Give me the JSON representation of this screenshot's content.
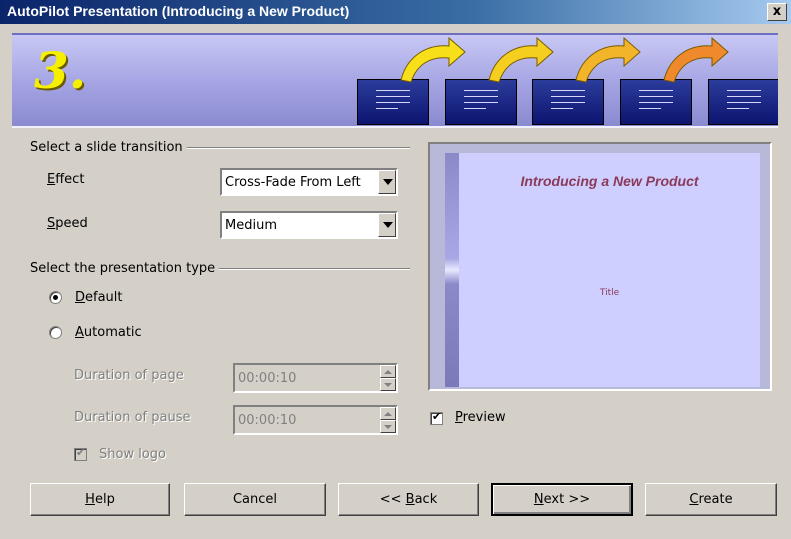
{
  "window": {
    "title": "AutoPilot Presentation (Introducing a New Product)",
    "close": "x"
  },
  "banner": {
    "step": "3."
  },
  "transition": {
    "group_label": "Select a slide transition",
    "effect_label": "Effect",
    "effect_value": "Cross-Fade From Left",
    "speed_label": "Speed",
    "speed_value": "Medium"
  },
  "presentation_type": {
    "group_label": "Select the presentation type",
    "default_label": "Default",
    "default_selected": true,
    "automatic_label": "Automatic",
    "automatic_selected": false,
    "duration_page_label": "Duration of page",
    "duration_page_value": "00:00:10",
    "duration_pause_label": "Duration of pause",
    "duration_pause_value": "00:00:10",
    "show_logo_label": "Show logo",
    "show_logo_checked": true
  },
  "preview": {
    "slide_title": "Introducing a New Product",
    "slide_subtitle": "Title",
    "checkbox_label": "Preview",
    "checked": true
  },
  "buttons": {
    "help": "Help",
    "cancel": "Cancel",
    "back": "<< Back",
    "next": "Next >>",
    "create": "Create"
  },
  "colors": {
    "titlebar": "#0a246a",
    "dialog": "#d4d0c8",
    "banner": "#a3a3e3",
    "step_number": "#f6f000",
    "slide_text": "#8a3a5a"
  }
}
